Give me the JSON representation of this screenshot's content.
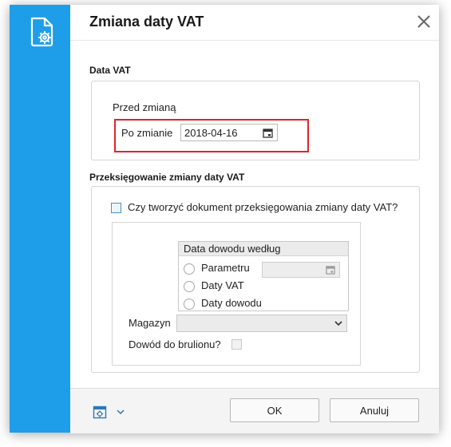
{
  "dialog": {
    "title": "Zmiana daty VAT",
    "side_icon": "document-gear-icon",
    "close_icon": "close-icon"
  },
  "data_vat": {
    "section_label": "Data VAT",
    "before_label": "Przed zmianą",
    "after_label": "Po zmianie",
    "after_value": "2018-04-16"
  },
  "rebooking": {
    "section_label": "Przeksięgowanie zmiany daty VAT",
    "create_doc_label": "Czy tworzyć dokument przeksięgowania zmiany daty VAT?",
    "create_doc_checked": false,
    "proof_date_group": {
      "title": "Data dowodu według",
      "options": [
        "Parametru",
        "Daty VAT",
        "Daty dowodu"
      ],
      "selected": null
    },
    "warehouse_label": "Magazyn",
    "warehouse_value": "",
    "draft_label": "Dowód do brulionu?",
    "draft_checked": false
  },
  "footer": {
    "ok_label": "OK",
    "cancel_label": "Anuluj"
  },
  "colors": {
    "sidebar": "#1e9ee8",
    "highlight": "#e0242a"
  }
}
